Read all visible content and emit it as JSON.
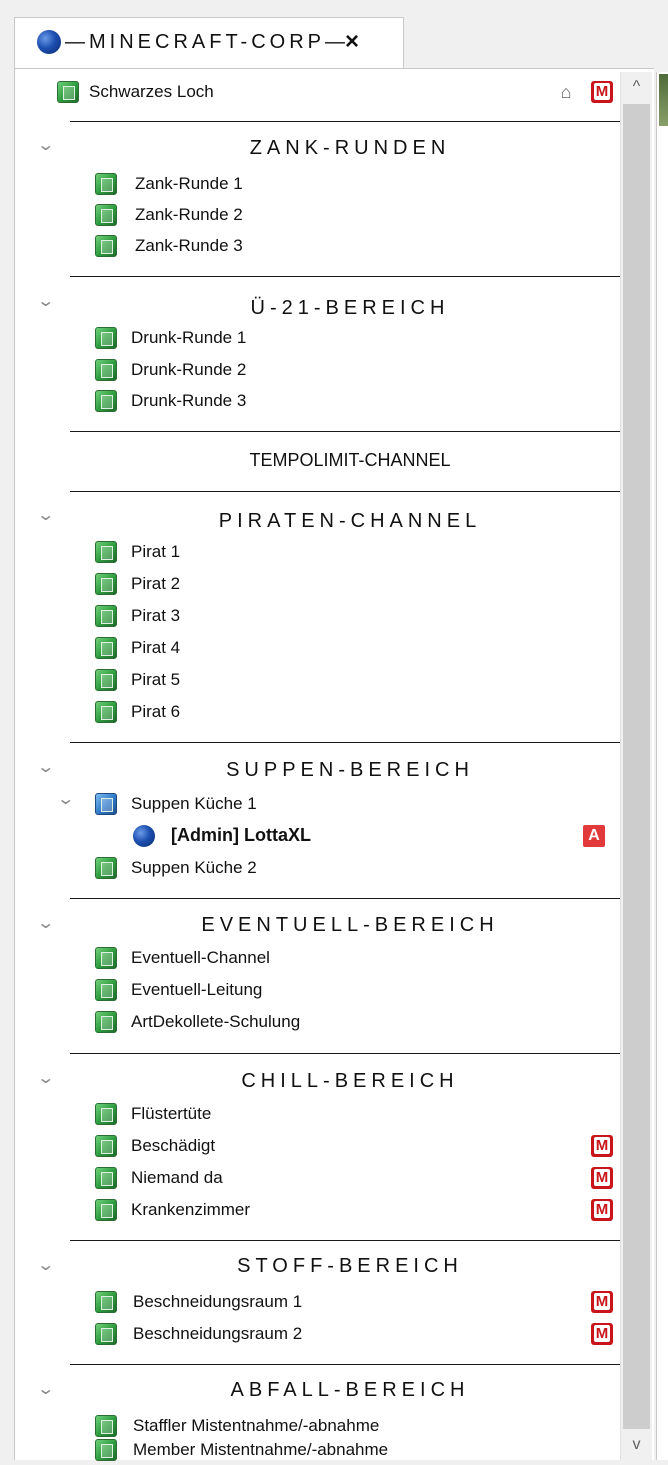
{
  "tab": {
    "title": "—MINECRAFT-CORP—",
    "close": "×"
  },
  "scrollbar": {
    "up": "^",
    "down": "v"
  },
  "root_channel": {
    "label": "Schwarzes Loch",
    "badges": [
      "home-icon",
      "moderated-icon"
    ]
  },
  "sections": [
    {
      "title": "ZANK-RUNDEN",
      "channels": [
        "Zank-Runde 1",
        "Zank-Runde 2",
        "Zank-Runde 3"
      ]
    },
    {
      "title": "Ü-21-BEREICH",
      "channels": [
        "Drunk-Runde 1",
        "Drunk-Runde 2",
        "Drunk-Runde 3"
      ]
    },
    {
      "title": "TEMPOLIMIT-CHANNEL",
      "channels": []
    },
    {
      "title": "PIRATEN-CHANNEL",
      "channels": [
        "Pirat 1",
        "Pirat 2",
        "Pirat 3",
        "Pirat 4",
        "Pirat 5",
        "Pirat 6"
      ]
    },
    {
      "title": "SUPPEN-BEREICH",
      "channels": [
        "Suppen Küche 1",
        "Suppen Küche 2"
      ]
    },
    {
      "title": "EVENTUELL-BEREICH",
      "channels": [
        "Eventuell-Channel",
        "Eventuell-Leitung",
        "ArtDekollete-Schulung"
      ]
    },
    {
      "title": "CHILL-BEREICH",
      "channels": [
        "Flüstertüte",
        "Beschädigt",
        "Niemand da",
        "Krankenzimmer"
      ]
    },
    {
      "title": "STOFF-BEREICH",
      "channels": [
        "Beschneidungsraum 1",
        "Beschneidungsraum 2"
      ]
    },
    {
      "title": "ABFALL-BEREICH",
      "channels": [
        "Staffler Mistentnahme/-abnahme",
        "Member Mistentnahme/-abnahme"
      ]
    }
  ],
  "user": {
    "name": "[Admin] LottaXL",
    "badge": "A"
  },
  "badge_m_letter": "M",
  "colors": {
    "moderated_badge": "#c8151b",
    "admin_badge": "#e23a3a",
    "channel_icon": "#2c9a3c"
  }
}
